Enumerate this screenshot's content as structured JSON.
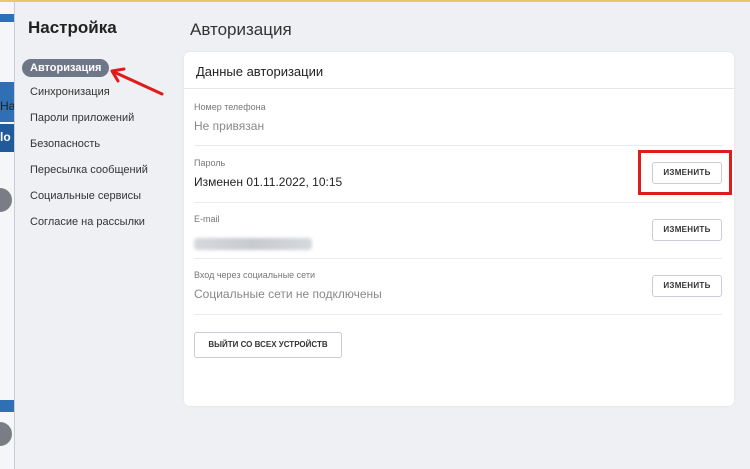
{
  "sidebar": {
    "title": "Настройка",
    "items": [
      {
        "label": "Авторизация",
        "active": true
      },
      {
        "label": "Синхронизация"
      },
      {
        "label": "Пароли приложений"
      },
      {
        "label": "Безопасность"
      },
      {
        "label": "Пересылка сообщений"
      },
      {
        "label": "Социальные сервисы"
      },
      {
        "label": "Согласие на рассылки"
      }
    ]
  },
  "background_window": {
    "text1": "На",
    "text2": "lo"
  },
  "main": {
    "page_title": "Авторизация",
    "card": {
      "header": "Данные авторизации",
      "phone": {
        "label": "Номер телефона",
        "value": "Не привязан"
      },
      "password": {
        "label": "Пароль",
        "value": "Изменен 01.11.2022, 10:15",
        "button": "ИЗМЕНИТЬ"
      },
      "email": {
        "label": "E-mail",
        "button": "ИЗМЕНИТЬ"
      },
      "social": {
        "label": "Вход через социальные сети",
        "value": "Социальные сети не подключены",
        "button": "ИЗМЕНИТЬ"
      },
      "logout_all": "ВЫЙТИ СО ВСЕХ УСТРОЙСТВ"
    }
  },
  "colors": {
    "accent_nav": "#6e7787",
    "annotation_red": "#e01b1b"
  }
}
